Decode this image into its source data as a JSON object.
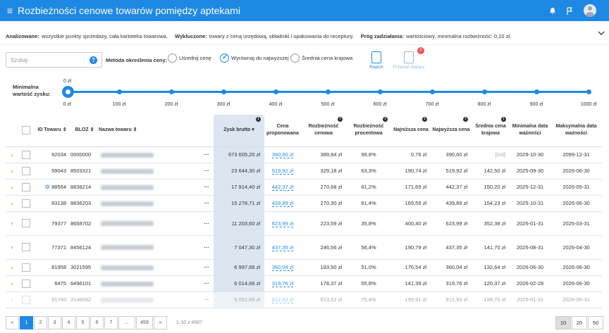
{
  "header": {
    "title": "Rozbieżności cenowe towarów pomiędzy aptekami",
    "menu_icon": "≡"
  },
  "info": {
    "analiz_label": "Analizowane:",
    "analiz_value": "wszystkie punkty sprzedaży, cała kartoteka towarowa.",
    "wyklucz_label": "Wykluczone:",
    "wyklucz_value": "towary z ceną urzędową, składniki i opakowania do receptury.",
    "prog_label": "Próg zadziałania:",
    "prog_value": "wartościowy, minimalna rozbieżność: 0,10 zł."
  },
  "search": {
    "placeholder": "Szukaj",
    "help": "?"
  },
  "metoda": {
    "label": "Metoda określenia ceny:",
    "opt1": "Uśrednij cenę",
    "opt2": "Wyrównaj do najwyższej",
    "opt3": "Średnia cena krajowa"
  },
  "tools": {
    "raport": "Raport",
    "przecen": "Przeceń towary",
    "badge": "0"
  },
  "slider": {
    "label_line1": "Minimalna",
    "label_line2": "wartość zysku:",
    "value": "0 zł",
    "ticks": [
      "0 zł",
      "100 zł",
      "200 zł",
      "300 zł",
      "400 zł",
      "500 zł",
      "600 zł",
      "700 zł",
      "800 zł",
      "900 zł",
      "1000 zł"
    ]
  },
  "columns": {
    "id": "ID Towaru",
    "bloz": "BLOZ",
    "nazwa": "Nazwa towaru",
    "zysk": "Zysk brutto",
    "cena_prop": "Cena proponowana",
    "roz_cen": "Rozbieżność cenowa",
    "roz_proc": "Rozbieżność procentowa",
    "najn": "Najniższa cena",
    "najw": "Najwyższa cena",
    "srednia": "Średnia cena krajowa",
    "min_data": "Minimalna data ważności",
    "max_data": "Maksymalna data ważności"
  },
  "rows": [
    {
      "id": "92034",
      "bloz": "0000000",
      "zysk": "673 605,20 zł",
      "cena": "390,60 zł",
      "roz": "389,84 zł",
      "proc": "99,8%",
      "najn": "0,76 zł",
      "najw": "390,60 zł",
      "sr": "[b/d]",
      "min": "2029-10-30",
      "max": "2099-12-31"
    },
    {
      "id": "59043",
      "bloz": "8503321",
      "zysk": "23 644,30 zł",
      "cena": "519,92 zł",
      "roz": "329,18 zł",
      "proc": "63,3%",
      "najn": "190,74 zł",
      "najw": "519,92 zł",
      "sr": "142,50 zł",
      "min": "2025-09-30",
      "max": "2026-06-30"
    },
    {
      "id": "88564",
      "bloz": "8836214",
      "zysk": "17 914,40 zł",
      "cena": "442,37 zł",
      "roz": "270,68 zł",
      "proc": "61,2%",
      "najn": "171,69 zł",
      "najw": "442,37 zł",
      "sr": "150,20 zł",
      "min": "2025-12-31",
      "max": "2026-05-31"
    },
    {
      "id": "83138",
      "bloz": "8836203",
      "zysk": "15 278,71 zł",
      "cena": "439,89 zł",
      "roz": "270,30 zł",
      "proc": "61,4%",
      "najn": "169,59 zł",
      "najw": "439,89 zł",
      "sr": "154,23 zł",
      "min": "2025-10-31",
      "max": "2026-06-30"
    },
    {
      "id": "79377",
      "bloz": "8658702",
      "zysk": "11 203,60 zł",
      "cena": "623,99 zł",
      "roz": "223,59 zł",
      "proc": "35,8%",
      "najn": "400,40 zł",
      "najw": "623,99 zł",
      "sr": "352,38 zł",
      "min": "2025-01-31",
      "max": "2025-03-31"
    },
    {
      "id": "77371",
      "bloz": "8456124",
      "zysk": "7 047,30 zł",
      "cena": "437,35 zł",
      "roz": "246,56 zł",
      "proc": "56,4%",
      "najn": "190,79 zł",
      "najw": "437,35 zł",
      "sr": "141,70 zł",
      "min": "2025-08-31",
      "max": "2026-04-30"
    },
    {
      "id": "81958",
      "bloz": "3021595",
      "zysk": "6 997,66 zł",
      "cena": "360,04 zł",
      "roz": "183,50 zł",
      "proc": "51,0%",
      "najn": "176,54 zł",
      "najw": "360,04 zł",
      "sr": "132,64 zł",
      "min": "2026-06-30",
      "max": "2026-06-30"
    },
    {
      "id": "6475",
      "bloz": "6496101",
      "zysk": "6 014,66 zł",
      "cena": "319,76 zł",
      "roz": "178,37 zł",
      "proc": "55,8%",
      "najn": "141,39 zł",
      "najw": "319,76 zł",
      "sr": "120,37 zł",
      "min": "2026-02-28",
      "max": "2026-06-30"
    },
    {
      "id": "91740",
      "bloz": "3146082",
      "zysk": "5 051,66 zł",
      "cena": "812,93 zł",
      "roz": "613,02 zł",
      "proc": "75,4%",
      "najn": "199,91 zł",
      "najw": "812,93 zł",
      "sr": "188,70 zł",
      "min": "2025-01-31",
      "max": "2026-05-31"
    }
  ],
  "pager": {
    "prev": "«",
    "pages": [
      "1",
      "2",
      "3",
      "4",
      "5",
      "6",
      "7",
      "...",
      "459"
    ],
    "next": "»",
    "count": "1-10 z 4587"
  },
  "sizes": [
    "10",
    "20",
    "50"
  ]
}
